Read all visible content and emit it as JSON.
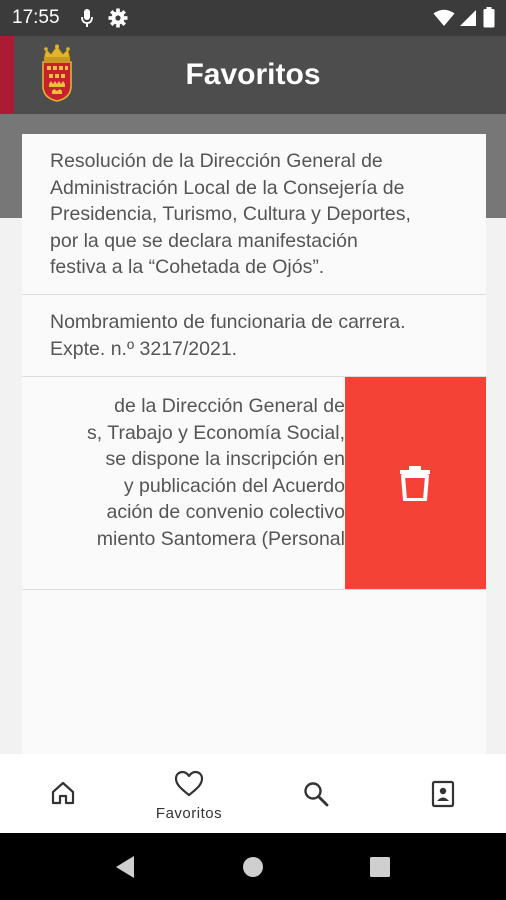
{
  "status_bar": {
    "time": "17:55",
    "icons": [
      "mic-icon",
      "settings-icon",
      "wifi-icon",
      "signal-icon",
      "battery-icon"
    ]
  },
  "app_bar": {
    "title": "Favoritos",
    "logo": "region-crest-logo",
    "colors": {
      "bar": "#4d4d4d",
      "accent_strip": "#ad1a35"
    }
  },
  "favorites": {
    "items": [
      {
        "text": "Resolución de la Dirección General de\nAdministración Local de la Consejería de\nPresidencia, Turismo, Cultura y Deportes,\npor la que se declara manifestación\nfestiva a la “Cohetada de Ojós”."
      },
      {
        "text": "Nombramiento de funcionaria de carrera.\nExpte. n.º 3217/2021."
      },
      {
        "lines": [
          "de la Dirección General de",
          "s, Trabajo y Economía Social,",
          "se dispone la inscripción en",
          "y publicación del Acuerdo",
          "ación de convenio colectivo",
          "miento Santomera (Personal"
        ],
        "swipe_action": {
          "icon": "delete-icon",
          "color": "#f44336"
        }
      }
    ]
  },
  "bottom_nav": {
    "items": [
      {
        "icon": "home-icon",
        "label": ""
      },
      {
        "icon": "heart-icon",
        "label": "Favoritos"
      },
      {
        "icon": "search-icon",
        "label": ""
      },
      {
        "icon": "contact-document-icon",
        "label": ""
      }
    ]
  },
  "system_nav": [
    "back-icon",
    "home-circle-icon",
    "recents-icon"
  ]
}
